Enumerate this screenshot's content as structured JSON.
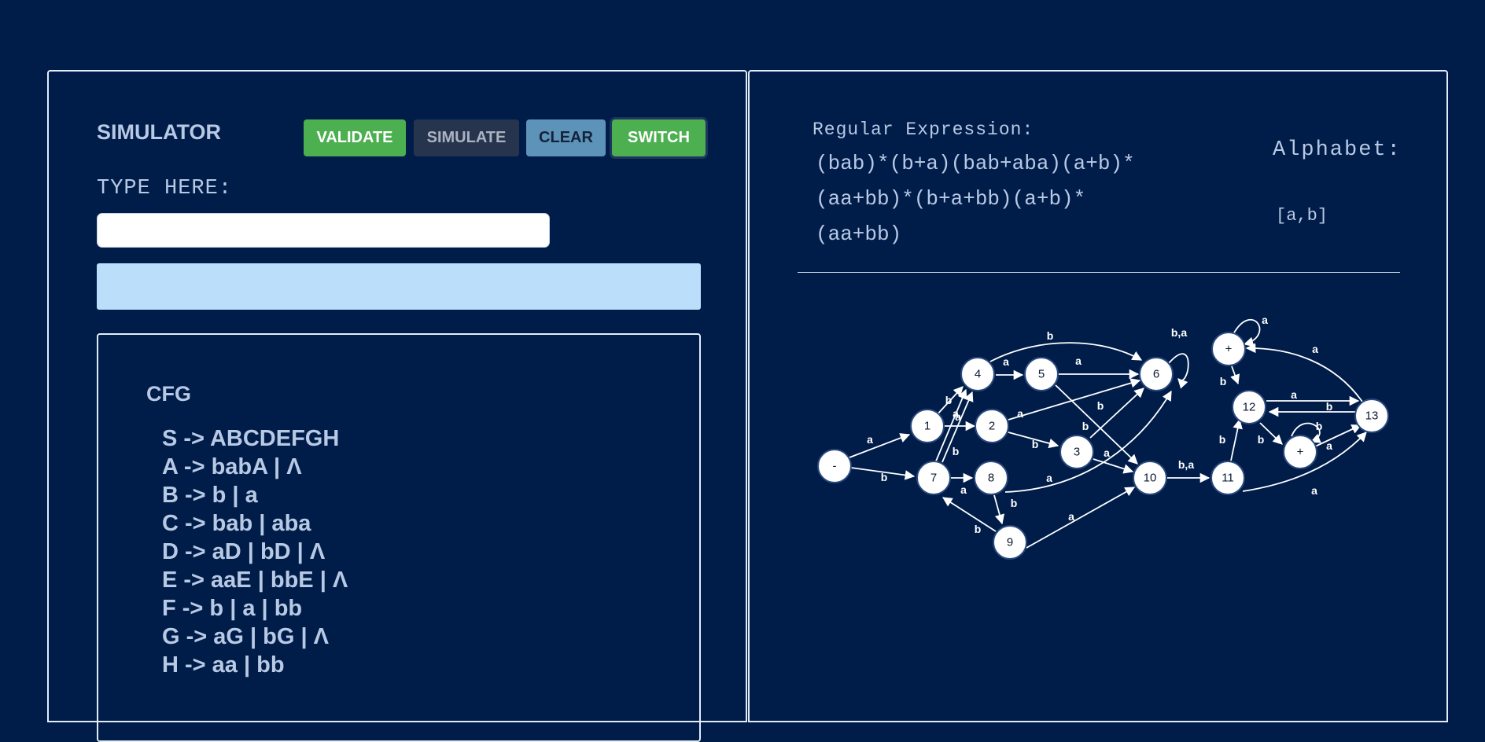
{
  "simulator": {
    "title": "SIMULATOR",
    "buttons": {
      "validate": "VALIDATE",
      "simulate": "SIMULATE",
      "clear": "CLEAR",
      "switch": "SWITCH"
    },
    "type_label": "TYPE HERE:",
    "input_value": "",
    "input_placeholder": ""
  },
  "cfg": {
    "title": "CFG",
    "rules": [
      "S -> ABCDEFGH",
      "A -> babA | Λ",
      "B -> b | a",
      "C -> bab | aba",
      "D -> aD | bD | Λ",
      "E -> aaE | bbE | Λ",
      "F -> b | a | bb",
      "G -> aG | bG | Λ",
      "H -> aa | bb"
    ]
  },
  "regex": {
    "label": "Regular Expression:",
    "lines": [
      "(bab)*(b+a)(bab+aba)(a+b)*",
      "(aa+bb)*(b+a+bb)(a+b)*",
      "(aa+bb)"
    ]
  },
  "alphabet": {
    "label": "Alphabet:",
    "value": "[a,b]"
  },
  "automaton": {
    "nodes": [
      {
        "id": "start",
        "label": "-"
      },
      {
        "id": "n1",
        "label": "1"
      },
      {
        "id": "n2",
        "label": "2"
      },
      {
        "id": "n3",
        "label": "3"
      },
      {
        "id": "n4",
        "label": "4"
      },
      {
        "id": "n5",
        "label": "5"
      },
      {
        "id": "n6",
        "label": "6"
      },
      {
        "id": "n7",
        "label": "7"
      },
      {
        "id": "n8",
        "label": "8"
      },
      {
        "id": "n9",
        "label": "9"
      },
      {
        "id": "n10",
        "label": "10"
      },
      {
        "id": "n11",
        "label": "11"
      },
      {
        "id": "n12",
        "label": "12"
      },
      {
        "id": "n13",
        "label": "13"
      },
      {
        "id": "acc1",
        "label": "+"
      },
      {
        "id": "acc2",
        "label": "+"
      }
    ],
    "edge_labels": {
      "start_1": "a",
      "start_7": "b",
      "1_4": "b",
      "1_2": "a",
      "7_4a": "a",
      "7_4b": "b",
      "7_8": "a",
      "8_9": "b",
      "8_6": "a",
      "9_7": "b",
      "9_10": "a",
      "4_5": "a",
      "4_6": "b",
      "5_6": "a",
      "5_10": "b",
      "2_6": "a",
      "2_3": "b",
      "3_6": "b",
      "3_10": "a",
      "6_6": "b,a",
      "10_11": "b,a",
      "11_12": "b",
      "11_13": "a",
      "12_13": "a",
      "13_12": "b",
      "12_acc2": "b",
      "acc2_acc2": "b",
      "acc2_13": "a",
      "acc1_acc1": "a",
      "acc1_12": "b",
      "13_acc1": "a"
    }
  }
}
